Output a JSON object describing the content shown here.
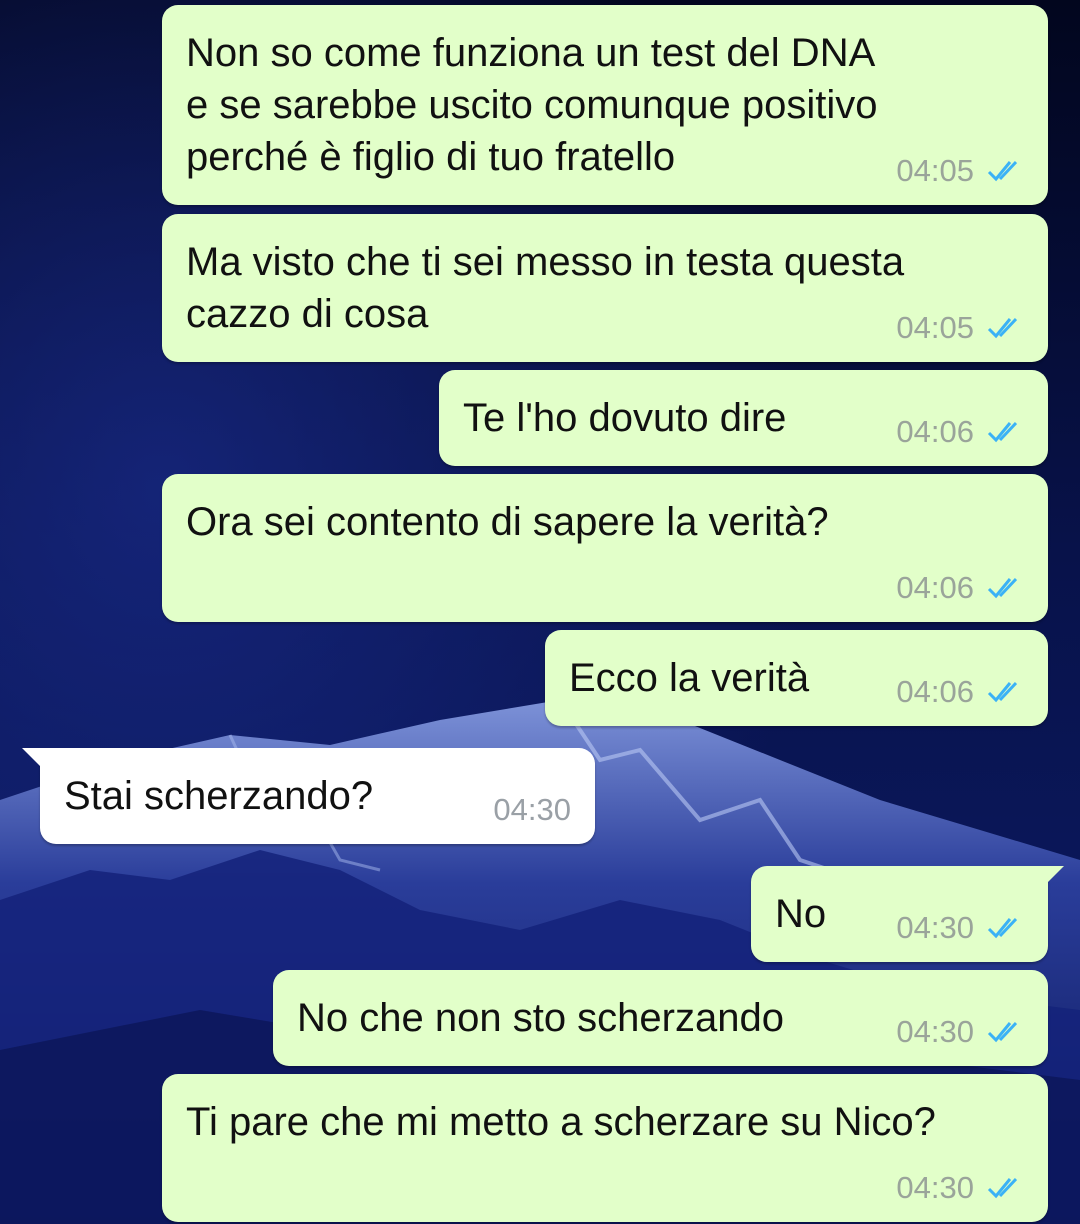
{
  "wallpaper": {
    "description_icon": "night-mountain-wallpaper",
    "sky_color": "#0a1445",
    "snow_color": "#8fa6e8"
  },
  "colors": {
    "outgoing_bubble": "#e2ffc9",
    "incoming_bubble": "#ffffff",
    "read_ticks": "#3bb2f6",
    "time_text": "#9aa49a"
  },
  "messages": [
    {
      "direction": "outgoing",
      "text": "Non so come funziona un test del DNA\ne se sarebbe uscito comunque positivo\nperché è figlio di tuo fratello",
      "time": "04:05",
      "status_icon": "double-check-read-icon"
    },
    {
      "direction": "outgoing",
      "text": "Ma visto che ti sei messo in testa questa\ncazzo di cosa",
      "time": "04:05",
      "status_icon": "double-check-read-icon"
    },
    {
      "direction": "outgoing",
      "text": "Te l'ho dovuto dire",
      "time": "04:06",
      "status_icon": "double-check-read-icon"
    },
    {
      "direction": "outgoing",
      "text": "Ora sei contento di sapere la verità?",
      "time": "04:06",
      "status_icon": "double-check-read-icon"
    },
    {
      "direction": "outgoing",
      "text": "Ecco la verità",
      "time": "04:06",
      "status_icon": "double-check-read-icon"
    },
    {
      "direction": "incoming",
      "text": "Stai scherzando?",
      "time": "04:30"
    },
    {
      "direction": "outgoing",
      "text": "No",
      "time": "04:30",
      "status_icon": "double-check-read-icon"
    },
    {
      "direction": "outgoing",
      "text": "No che non sto scherzando",
      "time": "04:30",
      "status_icon": "double-check-read-icon"
    },
    {
      "direction": "outgoing",
      "text": "Ti pare che mi metto a scherzare su Nico?",
      "time": "04:30",
      "status_icon": "double-check-read-icon"
    }
  ]
}
